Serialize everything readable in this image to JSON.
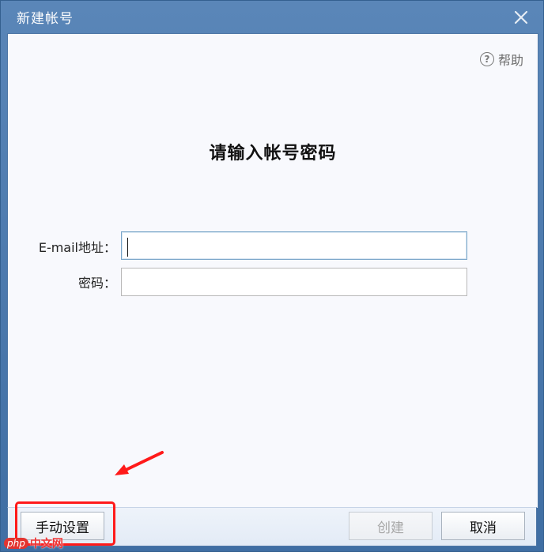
{
  "window": {
    "title": "新建帐号"
  },
  "help": {
    "label": "帮助",
    "icon_glyph": "?"
  },
  "form": {
    "heading": "请输入帐号密码",
    "email_label": "E-mail地址：",
    "email_value": "",
    "password_label": "密码：",
    "password_value": ""
  },
  "footer": {
    "manual_setup_label": "手动设置",
    "create_label": "创建",
    "cancel_label": "取消"
  },
  "annotation": {
    "highlight_color": "#ff1a1a"
  },
  "watermark": {
    "badge": "php",
    "text": "中文网"
  },
  "colors": {
    "titlebar": "#4a78ad",
    "client_bg": "#f8f9fd",
    "footer_bg": "#e8eef7"
  }
}
